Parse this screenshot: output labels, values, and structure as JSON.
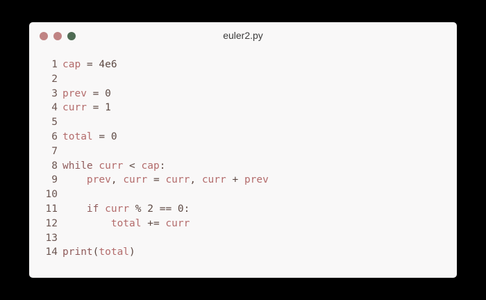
{
  "window": {
    "title": "euler2.py",
    "controls": [
      {
        "name": "close",
        "color": "#c08383"
      },
      {
        "name": "minimize",
        "color": "#c08383"
      },
      {
        "name": "maximize",
        "color": "#4e6b53"
      }
    ]
  },
  "colors": {
    "background": "#000000",
    "window": "#f9f8f8",
    "identifier": "#b36b6b",
    "text": "#5e4a44",
    "line_number": "#6b5550"
  },
  "code": {
    "lines": [
      {
        "number": "1",
        "tokens": [
          {
            "t": "cap",
            "k": "var"
          },
          {
            "t": " = ",
            "k": "op"
          },
          {
            "t": "4e6",
            "k": "num"
          }
        ]
      },
      {
        "number": "2",
        "tokens": []
      },
      {
        "number": "3",
        "tokens": [
          {
            "t": "prev",
            "k": "var"
          },
          {
            "t": " = ",
            "k": "op"
          },
          {
            "t": "0",
            "k": "num"
          }
        ]
      },
      {
        "number": "4",
        "tokens": [
          {
            "t": "curr",
            "k": "var"
          },
          {
            "t": " = ",
            "k": "op"
          },
          {
            "t": "1",
            "k": "num"
          }
        ]
      },
      {
        "number": "5",
        "tokens": []
      },
      {
        "number": "6",
        "tokens": [
          {
            "t": "total",
            "k": "var"
          },
          {
            "t": " = ",
            "k": "op"
          },
          {
            "t": "0",
            "k": "num"
          }
        ]
      },
      {
        "number": "7",
        "tokens": []
      },
      {
        "number": "8",
        "tokens": [
          {
            "t": "while",
            "k": "kw"
          },
          {
            "t": " ",
            "k": "ws"
          },
          {
            "t": "curr",
            "k": "var"
          },
          {
            "t": " < ",
            "k": "op"
          },
          {
            "t": "cap",
            "k": "var"
          },
          {
            "t": ":",
            "k": "punc"
          }
        ]
      },
      {
        "number": "9",
        "tokens": [
          {
            "t": "    ",
            "k": "ws"
          },
          {
            "t": "prev",
            "k": "var"
          },
          {
            "t": ", ",
            "k": "punc"
          },
          {
            "t": "curr",
            "k": "var"
          },
          {
            "t": " = ",
            "k": "op"
          },
          {
            "t": "curr",
            "k": "var"
          },
          {
            "t": ", ",
            "k": "punc"
          },
          {
            "t": "curr",
            "k": "var"
          },
          {
            "t": " + ",
            "k": "op"
          },
          {
            "t": "prev",
            "k": "var"
          }
        ]
      },
      {
        "number": "10",
        "tokens": []
      },
      {
        "number": "11",
        "tokens": [
          {
            "t": "    ",
            "k": "ws"
          },
          {
            "t": "if",
            "k": "kw"
          },
          {
            "t": " ",
            "k": "ws"
          },
          {
            "t": "curr",
            "k": "var"
          },
          {
            "t": " % ",
            "k": "op"
          },
          {
            "t": "2",
            "k": "num"
          },
          {
            "t": " == ",
            "k": "op"
          },
          {
            "t": "0",
            "k": "num"
          },
          {
            "t": ":",
            "k": "punc"
          }
        ]
      },
      {
        "number": "12",
        "tokens": [
          {
            "t": "        ",
            "k": "ws"
          },
          {
            "t": "total",
            "k": "var"
          },
          {
            "t": " += ",
            "k": "op"
          },
          {
            "t": "curr",
            "k": "var"
          }
        ]
      },
      {
        "number": "13",
        "tokens": []
      },
      {
        "number": "14",
        "tokens": [
          {
            "t": "print",
            "k": "kw"
          },
          {
            "t": "(",
            "k": "punc"
          },
          {
            "t": "total",
            "k": "var"
          },
          {
            "t": ")",
            "k": "punc"
          }
        ]
      }
    ]
  }
}
